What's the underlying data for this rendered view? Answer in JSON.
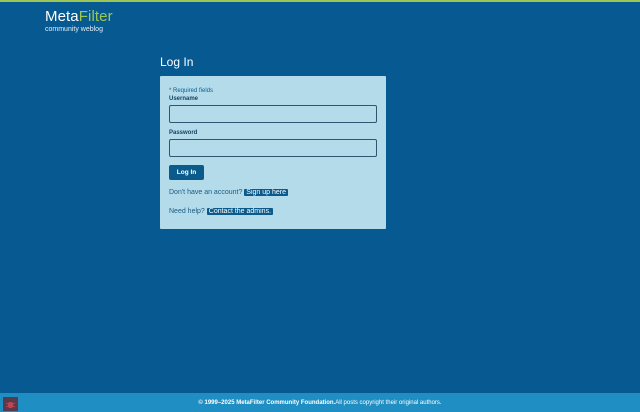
{
  "header": {
    "logo_meta": "Meta",
    "logo_filter": "Filter",
    "tagline": "community weblog"
  },
  "page": {
    "title": "Log In"
  },
  "form": {
    "required_star": "*",
    "required_text": " Required fields",
    "username_label": "Username",
    "username_value": "",
    "password_label": "Password",
    "password_value": "",
    "login_button": "Log In",
    "signup_prompt": "Don't have an account?",
    "signup_link": "Sign up here",
    "help_prompt": "Need help?",
    "help_link": "Contact the admins."
  },
  "footer": {
    "copyright": "© 1999–2025 MetaFilter Community Foundation.",
    "rights": " All posts copyright their original authors."
  },
  "colors": {
    "background": "#065a91",
    "accent_green": "#9cc754",
    "panel": "#b4dbea",
    "button": "#0b5a8c",
    "footer": "#1f8ec2"
  }
}
